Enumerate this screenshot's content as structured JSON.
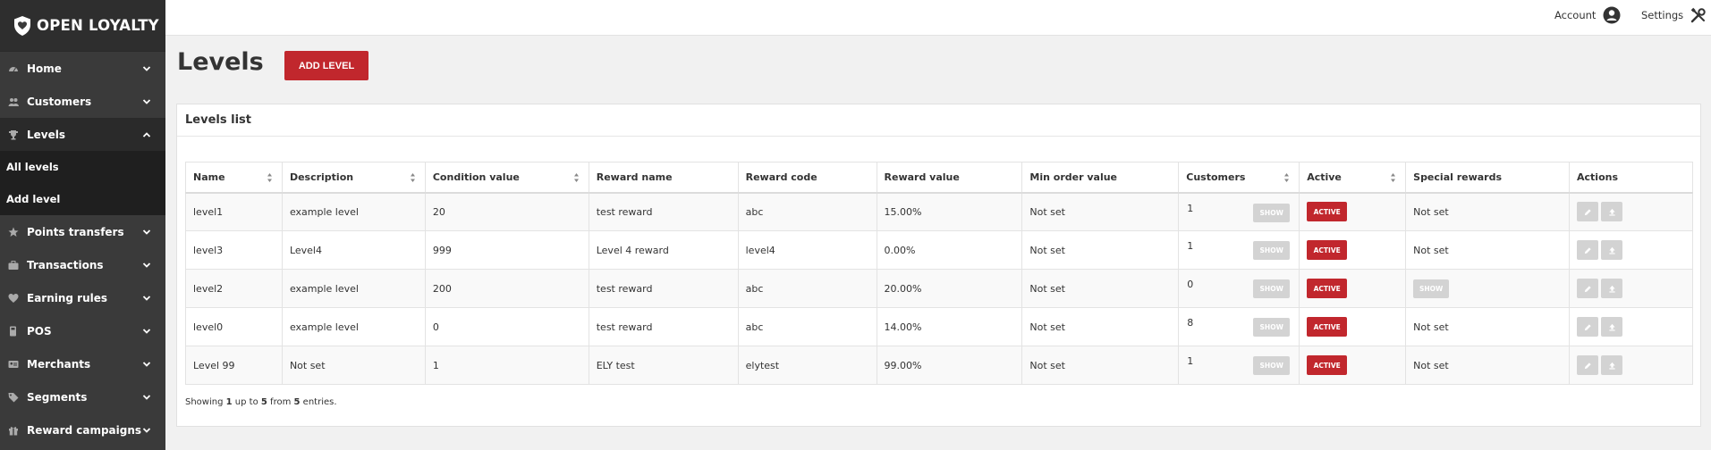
{
  "brand": {
    "name": "OPEN LOYALTY"
  },
  "sidebar": {
    "items": [
      {
        "label": "Home",
        "icon": "dashboard-icon"
      },
      {
        "label": "Customers",
        "icon": "users-icon"
      },
      {
        "label": "Levels",
        "icon": "trophy-icon",
        "expanded": true
      },
      {
        "label": "Points transfers",
        "icon": "star-icon"
      },
      {
        "label": "Transactions",
        "icon": "briefcase-icon"
      },
      {
        "label": "Earning rules",
        "icon": "heart-icon"
      },
      {
        "label": "POS",
        "icon": "pos-icon"
      },
      {
        "label": "Merchants",
        "icon": "id-card-icon"
      },
      {
        "label": "Segments",
        "icon": "tag-icon"
      },
      {
        "label": "Reward campaigns",
        "icon": "gift-icon"
      }
    ],
    "sub_items": [
      {
        "label": "All levels"
      },
      {
        "label": "Add level"
      }
    ]
  },
  "topbar": {
    "account_label": "Account",
    "settings_label": "Settings"
  },
  "page": {
    "title": "Levels",
    "add_button": "ADD LEVEL"
  },
  "panel": {
    "title": "Levels list"
  },
  "table": {
    "columns": [
      "Name",
      "Description",
      "Condition value",
      "Reward name",
      "Reward code",
      "Reward value",
      "Min order value",
      "Customers",
      "Active",
      "Special rewards",
      "Actions"
    ],
    "show_label": "SHOW",
    "active_label": "ACTIVE",
    "rows": [
      {
        "name": "level1",
        "description": "example level",
        "condition": "20",
        "reward_name": "test reward",
        "reward_code": "abc",
        "reward_value": "15.00%",
        "min_order": "Not set",
        "customers": "1",
        "special": "Not set"
      },
      {
        "name": "level3",
        "description": "Level4",
        "condition": "999",
        "reward_name": "Level 4 reward",
        "reward_code": "level4",
        "reward_value": "0.00%",
        "min_order": "Not set",
        "customers": "1",
        "special": "Not set"
      },
      {
        "name": "level2",
        "description": "example level",
        "condition": "200",
        "reward_name": "test reward",
        "reward_code": "abc",
        "reward_value": "20.00%",
        "min_order": "Not set",
        "customers": "0",
        "special": "SHOW"
      },
      {
        "name": "level0",
        "description": "example level",
        "condition": "0",
        "reward_name": "test reward",
        "reward_code": "abc",
        "reward_value": "14.00%",
        "min_order": "Not set",
        "customers": "8",
        "special": "Not set"
      },
      {
        "name": "Level 99",
        "description": "Not set",
        "condition": "1",
        "reward_name": "ELY test",
        "reward_code": "elytest",
        "reward_value": "99.00%",
        "min_order": "Not set",
        "customers": "1",
        "special": "Not set"
      }
    ]
  },
  "footer": {
    "prefix": "Showing",
    "from": "1",
    "mid1": "up to",
    "to": "5",
    "mid2": "from",
    "total": "5",
    "suffix": "entries."
  },
  "colors": {
    "accent": "#c1272d",
    "sidebar": "#3a3a3a",
    "sidebar_sub": "#1f1f1f"
  }
}
